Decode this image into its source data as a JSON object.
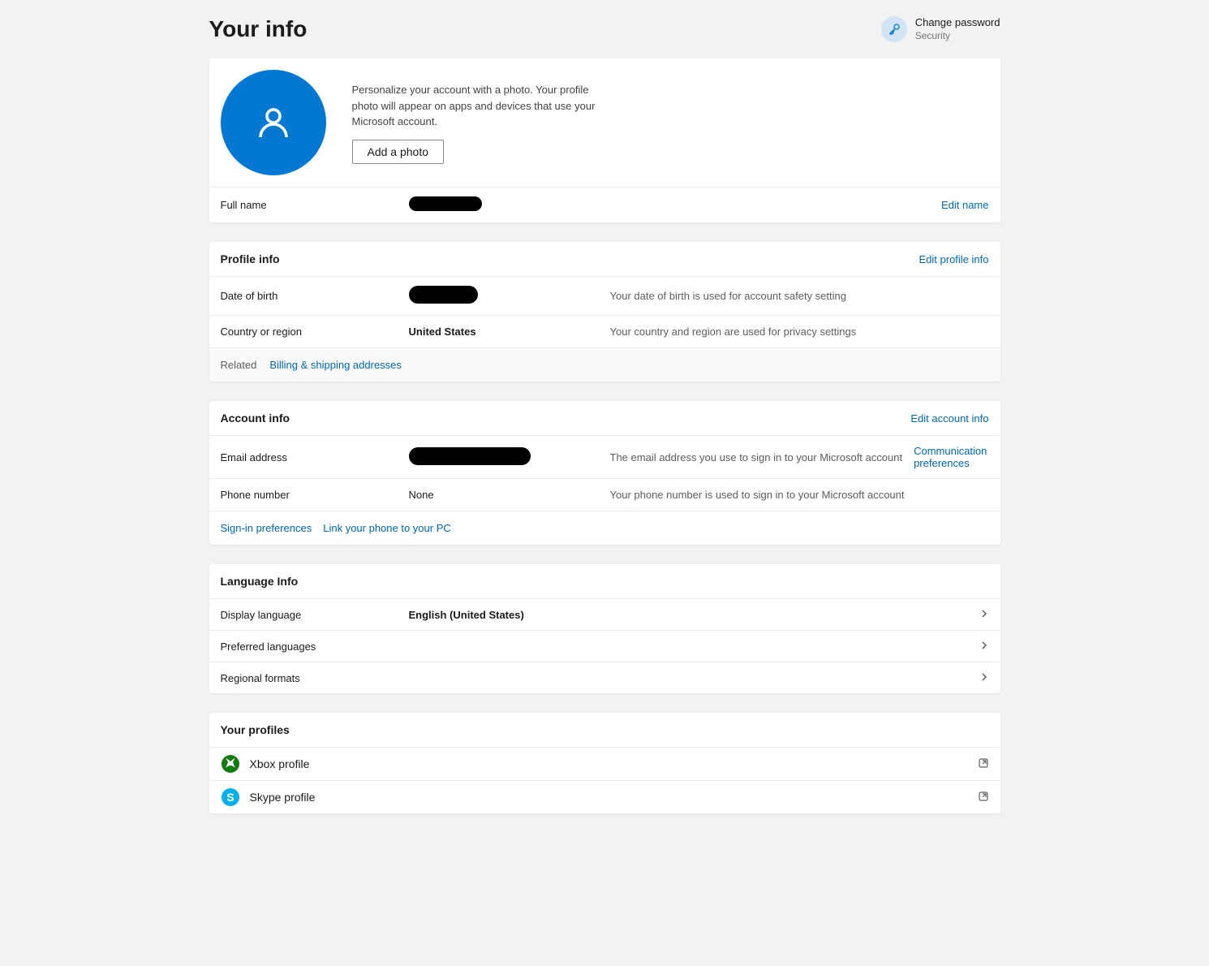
{
  "header": {
    "title": "Your info",
    "change_password": {
      "title": "Change password",
      "subtitle": "Security"
    }
  },
  "photo_card": {
    "description": "Personalize your account with a photo. Your profile photo will appear on apps and devices that use your Microsoft account.",
    "add_button": "Add a photo",
    "fullname_label": "Full name",
    "fullname_value": "",
    "edit_name": "Edit name"
  },
  "profile_info": {
    "title": "Profile info",
    "edit_link": "Edit profile info",
    "rows": [
      {
        "label": "Date of birth",
        "value": "",
        "desc": "Your date of birth is used for account safety setting"
      },
      {
        "label": "Country or region",
        "value": "United States",
        "desc": "Your country and region are used for privacy settings"
      }
    ],
    "related_label": "Related",
    "related_link": "Billing & shipping addresses"
  },
  "account_info": {
    "title": "Account info",
    "edit_link": "Edit account info",
    "rows": [
      {
        "label": "Email address",
        "value": "",
        "desc": "The email address you use to sign in to your Microsoft account",
        "extra_link": "Communication preferences"
      },
      {
        "label": "Phone number",
        "value": "None",
        "desc": "Your phone number is used to sign in to your Microsoft account"
      }
    ],
    "footer_links": [
      "Sign-in preferences",
      "Link your phone to your PC"
    ]
  },
  "language_info": {
    "title": "Language Info",
    "rows": [
      {
        "label": "Display language",
        "value": "English (United States)"
      },
      {
        "label": "Preferred languages",
        "value": ""
      },
      {
        "label": "Regional formats",
        "value": ""
      }
    ]
  },
  "profiles": {
    "title": "Your profiles",
    "items": [
      {
        "name": "Xbox profile",
        "icon": "xbox"
      },
      {
        "name": "Skype profile",
        "icon": "skype"
      }
    ]
  }
}
